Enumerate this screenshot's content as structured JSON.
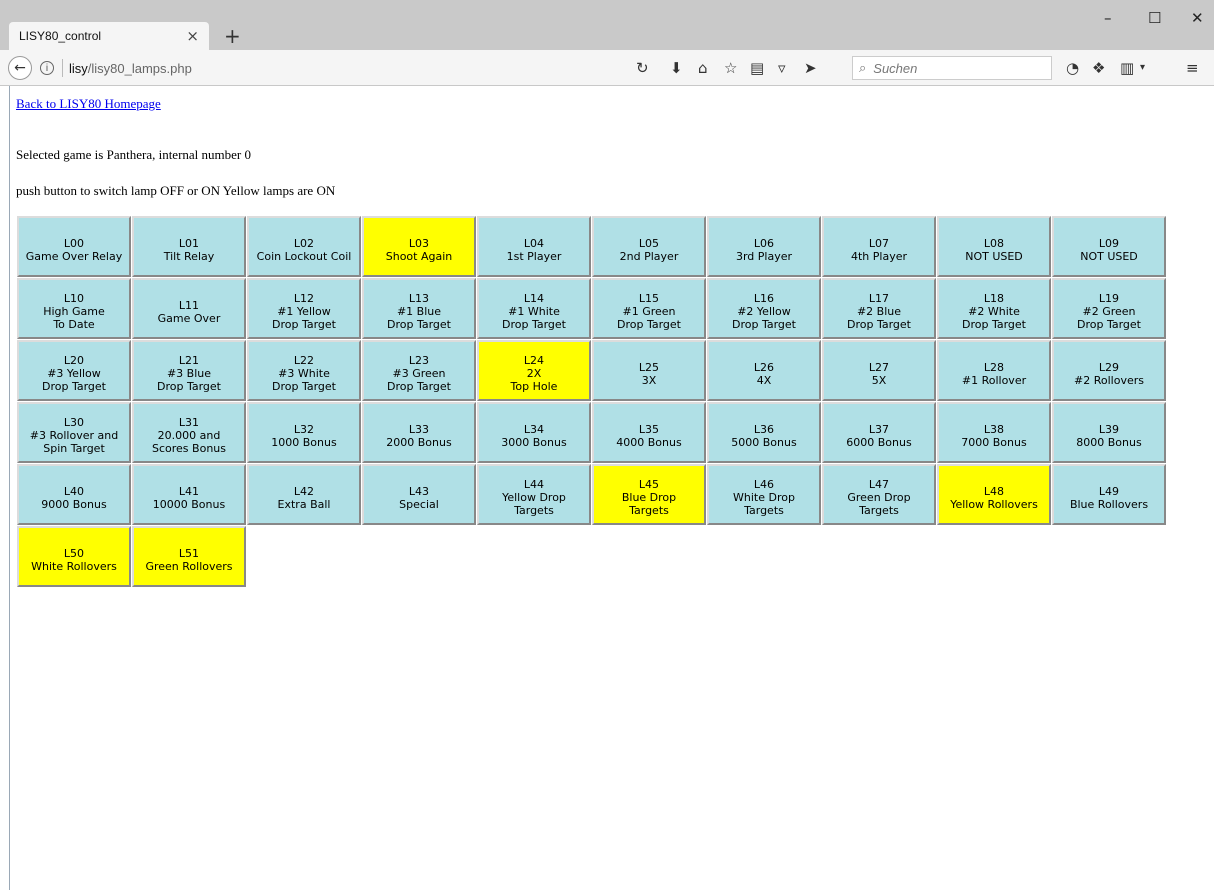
{
  "browser": {
    "tab_title": "LISY80_control",
    "tab_close": "×",
    "new_tab": "+",
    "url_host": "lisy",
    "url_path": "/lisy80_lamps.php",
    "search_placeholder": "Suchen",
    "window_controls": {
      "minimize": "–",
      "maximize": "☐",
      "close": "✕"
    }
  },
  "page": {
    "home_link": "Back to LISY80 Homepage",
    "game_info": "Selected game is Panthera, internal number 0",
    "instructions": "push button to switch lamp OFF or ON Yellow lamps are ON"
  },
  "colors": {
    "lamp_off": "#b0e0e6",
    "lamp_on": "#ffff00",
    "link": "#0000ee"
  },
  "lamps": [
    {
      "id": "L00",
      "label": "Game Over Relay",
      "on": false
    },
    {
      "id": "L01",
      "label": "Tilt Relay",
      "on": false
    },
    {
      "id": "L02",
      "label": "Coin Lockout Coil",
      "on": false
    },
    {
      "id": "L03",
      "label": "Shoot Again",
      "on": true
    },
    {
      "id": "L04",
      "label": "1st Player",
      "on": false
    },
    {
      "id": "L05",
      "label": "2nd Player",
      "on": false
    },
    {
      "id": "L06",
      "label": "3rd Player",
      "on": false
    },
    {
      "id": "L07",
      "label": "4th Player",
      "on": false
    },
    {
      "id": "L08",
      "label": "NOT USED",
      "on": false
    },
    {
      "id": "L09",
      "label": "NOT USED",
      "on": false
    },
    {
      "id": "L10",
      "label": "High Game\nTo Date",
      "on": false
    },
    {
      "id": "L11",
      "label": "Game Over",
      "on": false
    },
    {
      "id": "L12",
      "label": "#1 Yellow\nDrop Target",
      "on": false
    },
    {
      "id": "L13",
      "label": "#1 Blue\nDrop Target",
      "on": false
    },
    {
      "id": "L14",
      "label": "#1 White\nDrop Target",
      "on": false
    },
    {
      "id": "L15",
      "label": "#1 Green\nDrop Target",
      "on": false
    },
    {
      "id": "L16",
      "label": "#2 Yellow\nDrop Target",
      "on": false
    },
    {
      "id": "L17",
      "label": "#2 Blue\nDrop Target",
      "on": false
    },
    {
      "id": "L18",
      "label": "#2 White\nDrop Target",
      "on": false
    },
    {
      "id": "L19",
      "label": "#2 Green\nDrop Target",
      "on": false
    },
    {
      "id": "L20",
      "label": "#3 Yellow\nDrop Target",
      "on": false
    },
    {
      "id": "L21",
      "label": "#3 Blue\nDrop Target",
      "on": false
    },
    {
      "id": "L22",
      "label": "#3 White\nDrop Target",
      "on": false
    },
    {
      "id": "L23",
      "label": "#3 Green\nDrop Target",
      "on": false
    },
    {
      "id": "L24",
      "label": "2X\nTop Hole",
      "on": true
    },
    {
      "id": "L25",
      "label": "3X",
      "on": false
    },
    {
      "id": "L26",
      "label": "4X",
      "on": false
    },
    {
      "id": "L27",
      "label": "5X",
      "on": false
    },
    {
      "id": "L28",
      "label": "#1 Rollover",
      "on": false
    },
    {
      "id": "L29",
      "label": "#2 Rollovers",
      "on": false
    },
    {
      "id": "L30",
      "label": "#3 Rollover and\nSpin Target",
      "on": false
    },
    {
      "id": "L31",
      "label": "20.000 and\nScores Bonus",
      "on": false
    },
    {
      "id": "L32",
      "label": "1000 Bonus",
      "on": false
    },
    {
      "id": "L33",
      "label": "2000 Bonus",
      "on": false
    },
    {
      "id": "L34",
      "label": "3000 Bonus",
      "on": false
    },
    {
      "id": "L35",
      "label": "4000 Bonus",
      "on": false
    },
    {
      "id": "L36",
      "label": "5000 Bonus",
      "on": false
    },
    {
      "id": "L37",
      "label": "6000 Bonus",
      "on": false
    },
    {
      "id": "L38",
      "label": "7000 Bonus",
      "on": false
    },
    {
      "id": "L39",
      "label": "8000 Bonus",
      "on": false
    },
    {
      "id": "L40",
      "label": "9000 Bonus",
      "on": false
    },
    {
      "id": "L41",
      "label": "10000 Bonus",
      "on": false
    },
    {
      "id": "L42",
      "label": "Extra Ball",
      "on": false
    },
    {
      "id": "L43",
      "label": "Special",
      "on": false
    },
    {
      "id": "L44",
      "label": "Yellow Drop\nTargets",
      "on": false
    },
    {
      "id": "L45",
      "label": "Blue Drop\nTargets",
      "on": true
    },
    {
      "id": "L46",
      "label": "White Drop\nTargets",
      "on": false
    },
    {
      "id": "L47",
      "label": "Green Drop\nTargets",
      "on": false
    },
    {
      "id": "L48",
      "label": "Yellow Rollovers",
      "on": true
    },
    {
      "id": "L49",
      "label": "Blue Rollovers",
      "on": false
    },
    {
      "id": "L50",
      "label": "White Rollovers",
      "on": true
    },
    {
      "id": "L51",
      "label": "Green Rollovers",
      "on": true
    }
  ]
}
